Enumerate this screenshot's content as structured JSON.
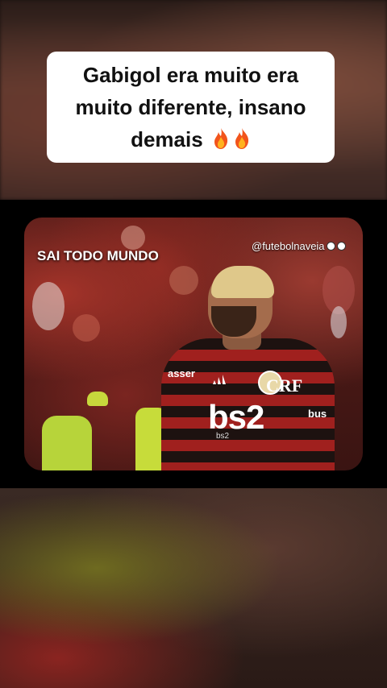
{
  "caption": {
    "text": "Gabigol era muito era muito diferente, insano demais"
  },
  "caption_icons": [
    "fire-emoji",
    "fire-emoji"
  ],
  "video": {
    "overlay_title": "SAI TODO MUNDO",
    "handle": "@futebolnaveia",
    "handle_icons": [
      "soccer-ball-icon",
      "soccer-ball-icon"
    ],
    "jersey": {
      "sponsor": "bs2",
      "sponsor_sub": "bs2",
      "sleeve_left": "asser",
      "sleeve_right": "bus",
      "crest": "CRF"
    }
  },
  "colors": {
    "jersey_red": "#a0201e",
    "jersey_black": "#1d1210",
    "steward_vest": "#b7d43a",
    "caption_bg": "#ffffff"
  }
}
